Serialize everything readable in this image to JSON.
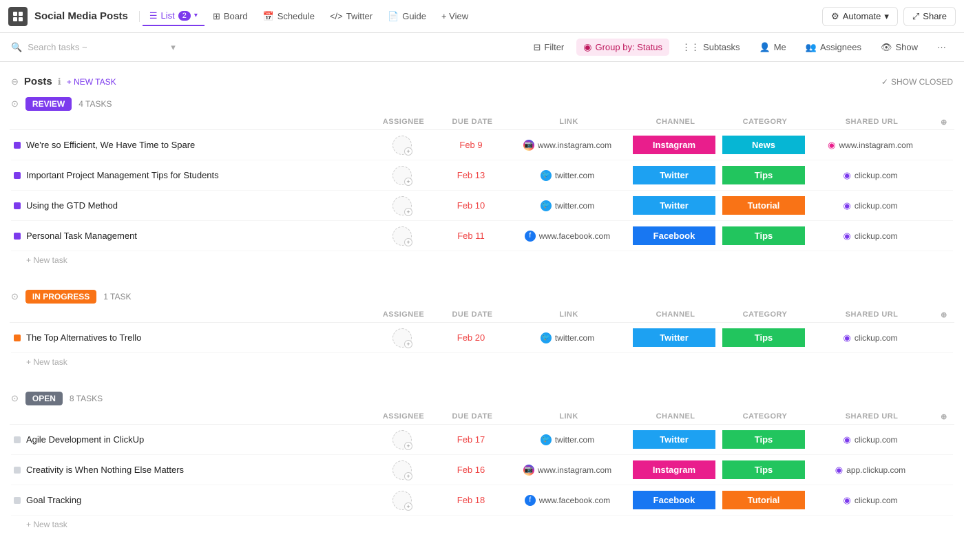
{
  "topbar": {
    "app_icon": "grid",
    "project_title": "Social Media Posts",
    "tabs": [
      {
        "label": "List",
        "badge": "2",
        "active": true,
        "icon": "list"
      },
      {
        "label": "Board",
        "active": false,
        "icon": "board"
      },
      {
        "label": "Schedule",
        "active": false,
        "icon": "calendar"
      },
      {
        "label": "Twitter",
        "active": false,
        "icon": "code"
      },
      {
        "label": "Guide",
        "active": false,
        "icon": "doc"
      }
    ],
    "view_btn": "+ View",
    "automate_btn": "Automate",
    "share_btn": "Share"
  },
  "filterbar": {
    "search_placeholder": "Search tasks ~",
    "filter_btn": "Filter",
    "group_by": "Group by: Status",
    "subtasks_btn": "Subtasks",
    "me_btn": "Me",
    "assignees_btn": "Assignees",
    "show_btn": "Show",
    "more_btn": "..."
  },
  "section": {
    "title": "Posts",
    "show_closed": "SHOW CLOSED",
    "new_task_btn": "+ NEW TASK"
  },
  "groups": [
    {
      "id": "review",
      "status_label": "REVIEW",
      "status_class": "status-review",
      "task_count": "4 TASKS",
      "columns": [
        "ASSIGNEE",
        "DUE DATE",
        "LINK",
        "CHANNEL",
        "CATEGORY",
        "SHARED URL"
      ],
      "tasks": [
        {
          "name": "We're so Efficient, We Have Time to Spare",
          "dot_class": "dot-purple",
          "assignee": "",
          "due_date": "Feb 9",
          "link_type": "instagram",
          "link_text": "www.instagram.com",
          "channel": "Instagram",
          "channel_class": "ch-instagram",
          "category": "News",
          "category_class": "cat-news",
          "shared_url": "www.instagram.com",
          "shared_icon_class": "instagram-icon"
        },
        {
          "name": "Important Project Management Tips for Students",
          "dot_class": "dot-purple",
          "assignee": "",
          "due_date": "Feb 13",
          "link_type": "twitter",
          "link_text": "twitter.com",
          "channel": "Twitter",
          "channel_class": "ch-twitter",
          "category": "Tips",
          "category_class": "cat-tips",
          "shared_url": "clickup.com",
          "shared_icon_class": "cu"
        },
        {
          "name": "Using the GTD Method",
          "dot_class": "dot-purple",
          "assignee": "",
          "due_date": "Feb 10",
          "link_type": "twitter",
          "link_text": "twitter.com",
          "channel": "Twitter",
          "channel_class": "ch-twitter",
          "category": "Tutorial",
          "category_class": "cat-tutorial",
          "shared_url": "clickup.com",
          "shared_icon_class": "cu"
        },
        {
          "name": "Personal Task Management",
          "dot_class": "dot-purple",
          "assignee": "",
          "due_date": "Feb 11",
          "link_type": "facebook",
          "link_text": "www.facebook.com",
          "channel": "Facebook",
          "channel_class": "ch-facebook",
          "category": "Tips",
          "category_class": "cat-tips",
          "shared_url": "clickup.com",
          "shared_icon_class": "cu"
        }
      ],
      "new_task_label": "+ New task"
    },
    {
      "id": "inprogress",
      "status_label": "IN PROGRESS",
      "status_class": "status-inprogress",
      "task_count": "1 TASK",
      "columns": [
        "ASSIGNEE",
        "DUE DATE",
        "LINK",
        "CHANNEL",
        "CATEGORY",
        "SHARED URL"
      ],
      "tasks": [
        {
          "name": "The Top Alternatives to Trello",
          "dot_class": "dot-orange",
          "assignee": "",
          "due_date": "Feb 20",
          "link_type": "twitter",
          "link_text": "twitter.com",
          "channel": "Twitter",
          "channel_class": "ch-twitter",
          "category": "Tips",
          "category_class": "cat-tips",
          "shared_url": "clickup.com",
          "shared_icon_class": "cu"
        }
      ],
      "new_task_label": "+ New task"
    },
    {
      "id": "open",
      "status_label": "OPEN",
      "status_class": "status-open",
      "task_count": "8 TASKS",
      "columns": [
        "ASSIGNEE",
        "DUE DATE",
        "LINK",
        "CHANNEL",
        "CATEGORY",
        "SHARED URL"
      ],
      "tasks": [
        {
          "name": "Agile Development in ClickUp",
          "dot_class": "dot-gray",
          "assignee": "",
          "due_date": "Feb 17",
          "link_type": "twitter",
          "link_text": "twitter.com",
          "channel": "Twitter",
          "channel_class": "ch-twitter",
          "category": "Tips",
          "category_class": "cat-tips",
          "shared_url": "clickup.com",
          "shared_icon_class": "cu"
        },
        {
          "name": "Creativity is When Nothing Else Matters",
          "dot_class": "dot-gray",
          "assignee": "",
          "due_date": "Feb 16",
          "link_type": "instagram",
          "link_text": "www.instagram.com",
          "channel": "Instagram",
          "channel_class": "ch-instagram",
          "category": "Tips",
          "category_class": "cat-tips",
          "shared_url": "app.clickup.com",
          "shared_icon_class": "cu"
        },
        {
          "name": "Goal Tracking",
          "dot_class": "dot-gray",
          "assignee": "",
          "due_date": "Feb 18",
          "link_type": "facebook",
          "link_text": "www.facebook.com",
          "channel": "Facebook",
          "channel_class": "ch-facebook",
          "category": "Tutorial",
          "category_class": "cat-tutorial",
          "shared_url": "clickup.com",
          "shared_icon_class": "cu"
        }
      ],
      "new_task_label": "+ New task"
    }
  ],
  "icons": {
    "chevron_down": "▾",
    "search": "🔍",
    "filter": "⊟",
    "group_by": "◉",
    "subtasks": "⋮",
    "check": "✓",
    "plus": "+",
    "info": "ℹ",
    "more": "···"
  }
}
